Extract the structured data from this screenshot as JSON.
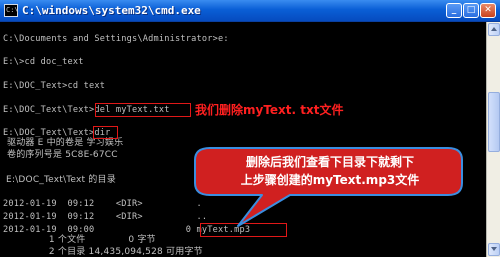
{
  "window": {
    "title": "C:\\windows\\system32\\cmd.exe",
    "icon_text": "C:\\",
    "buttons": {
      "minimize": "_",
      "maximize": "□",
      "close": "✕"
    }
  },
  "console": {
    "lines": [
      "C:\\Documents and Settings\\Administrator>e:",
      "E:\\>cd doc_text",
      "E:\\DOC_Text>cd text",
      "E:\\DOC_Text\\Text>del myText.txt",
      "E:\\DOC_Text\\Text>dir",
      "驱动器 E 中的卷是 学习娱乐",
      "卷的序列号是 5C8E-67CC",
      " E:\\DOC_Text\\Text 的目录",
      "2012-01-19  09:12    <DIR>          .",
      "2012-01-19  09:12    <DIR>          ..",
      "2012-01-19  09:00                 0 myText.mp3",
      "               1 个文件              0 字节",
      "               2 个目录 14,435,094,528 可用字节"
    ]
  },
  "annotations": {
    "delete_note": "我们删除myText. txt文件",
    "bubble_line1": "删除后我们查看下目录下就剩下",
    "bubble_line2": "上步骤创建的myText.mp3文件",
    "colors": {
      "highlight": "#e01818",
      "bubble_fill": "#d02020",
      "bubble_border": "#3a8ee0"
    }
  }
}
